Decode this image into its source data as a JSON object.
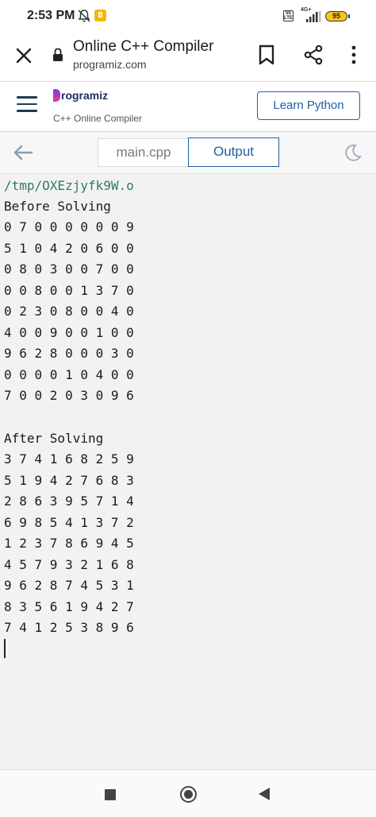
{
  "status_bar": {
    "time": "2:53 PM",
    "network_label": "4G+",
    "volte_label": "Vo LTE",
    "battery_level": "95"
  },
  "browser": {
    "title": "Online C++ Compiler",
    "url": "programiz.com"
  },
  "site": {
    "logo_text": "rogramiz",
    "logo_subtitle": "C++ Online Compiler",
    "learn_button": "Learn Python"
  },
  "tabs": {
    "file_tab": "main.cpp",
    "output_tab": "Output"
  },
  "output": {
    "path": "/tmp/OXEzjyfk9W.o",
    "before_heading": "Before Solving",
    "before_rows": [
      "0 7 0 0 0 0 0 0 9",
      "5 1 0 4 2 0 6 0 0",
      "0 8 0 3 0 0 7 0 0",
      "0 0 8 0 0 1 3 7 0",
      "0 2 3 0 8 0 0 4 0",
      "4 0 0 9 0 0 1 0 0",
      "9 6 2 8 0 0 0 3 0",
      "0 0 0 0 1 0 4 0 0",
      "7 0 0 2 0 3 0 9 6"
    ],
    "after_heading": "After Solving",
    "after_rows": [
      "3 7 4 1 6 8 2 5 9",
      "5 1 9 4 2 7 6 8 3",
      "2 8 6 3 9 5 7 1 4",
      "6 9 8 5 4 1 3 7 2",
      "1 2 3 7 8 6 9 4 5",
      "4 5 7 9 3 2 1 6 8",
      "9 6 2 8 7 4 5 3 1",
      "8 3 5 6 1 9 4 2 7",
      "7 4 1 2 5 3 8 9 6"
    ]
  }
}
